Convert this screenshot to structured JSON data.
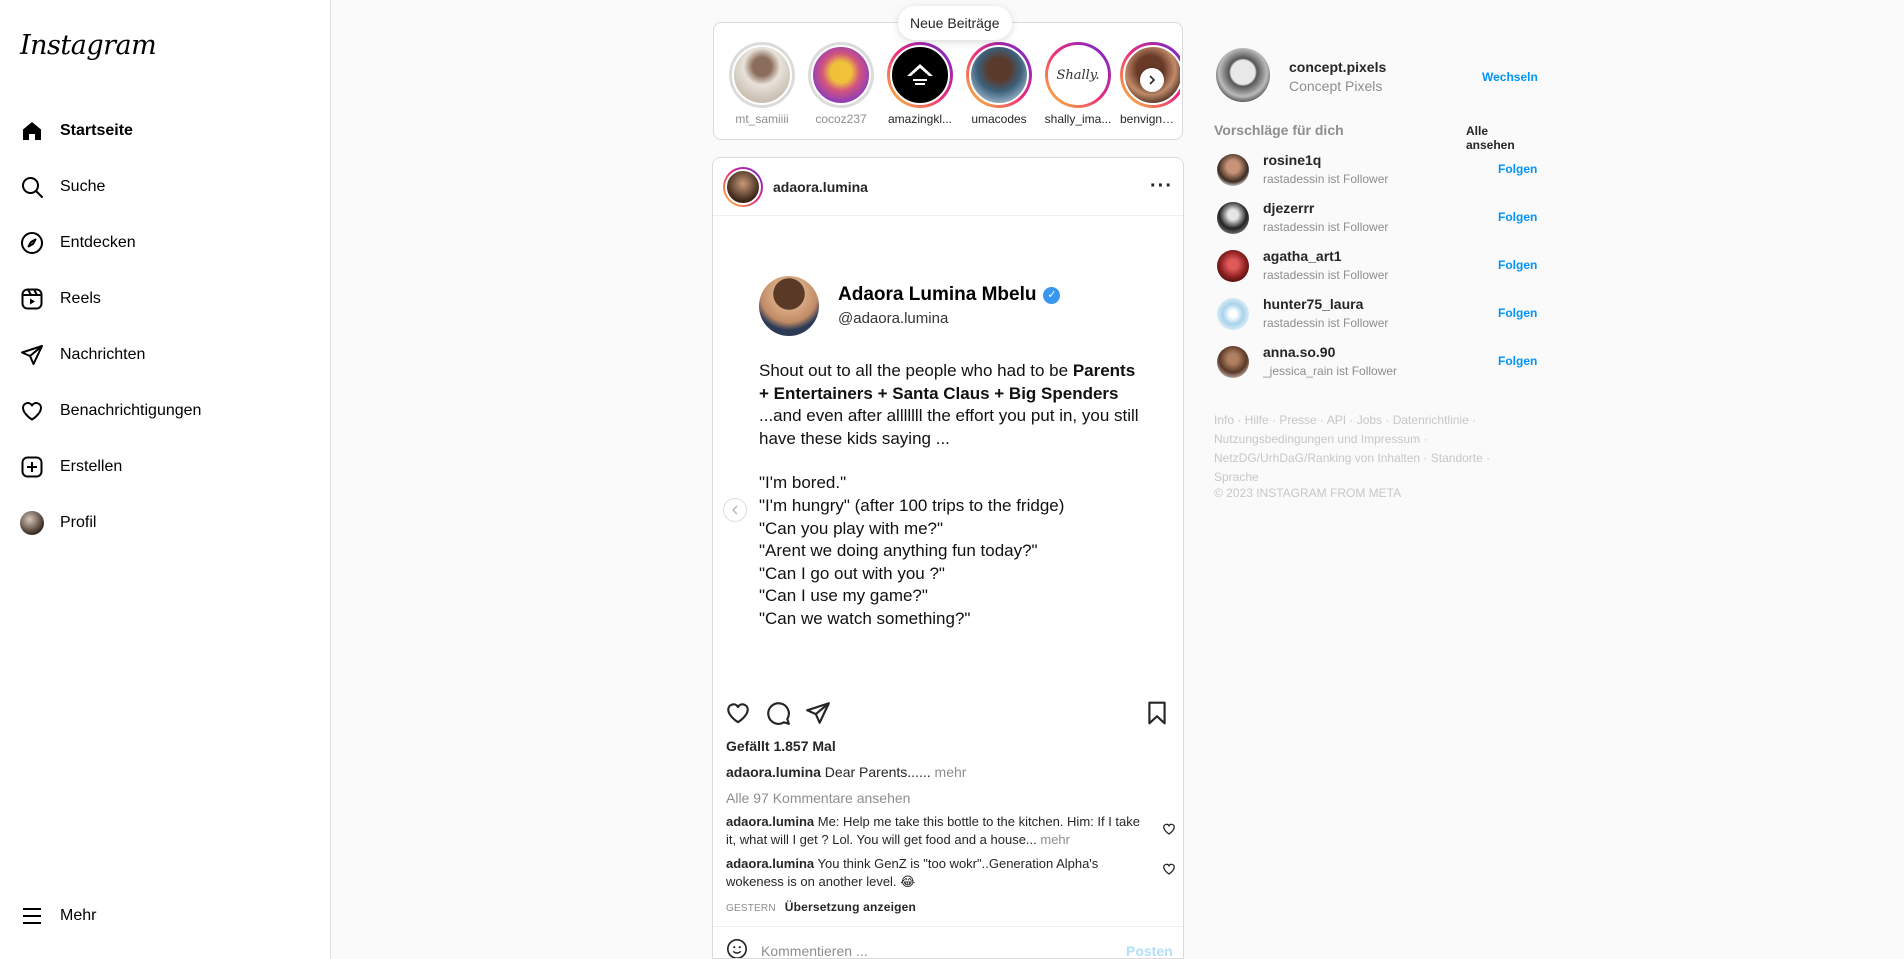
{
  "nav": {
    "logo": "Instagram",
    "items": [
      {
        "label": "Startseite",
        "icon": "home-icon"
      },
      {
        "label": "Suche",
        "icon": "search-icon"
      },
      {
        "label": "Entdecken",
        "icon": "compass-icon"
      },
      {
        "label": "Reels",
        "icon": "reels-icon"
      },
      {
        "label": "Nachrichten",
        "icon": "messages-icon"
      },
      {
        "label": "Benachrichtigungen",
        "icon": "heart-icon"
      },
      {
        "label": "Erstellen",
        "icon": "create-icon"
      },
      {
        "label": "Profil",
        "icon": "profile-avatar"
      }
    ],
    "more": "Mehr"
  },
  "stories": {
    "new_posts": "Neue Beiträge",
    "items": [
      {
        "name": "mt_samiiii",
        "seen": true
      },
      {
        "name": "cocoz237",
        "seen": true
      },
      {
        "name": "amazingkl...",
        "seen": false
      },
      {
        "name": "umacodes",
        "seen": false
      },
      {
        "name": "shally_ima...",
        "seen": false
      },
      {
        "name": "benvigna_...",
        "seen": false
      }
    ]
  },
  "post": {
    "username": "adaora.lumina",
    "image": {
      "name": "Adaora Lumina Mbelu",
      "handle": "@adaora.lumina",
      "intro": "Shout out to all the people who had to be",
      "bold": "Parents + Entertainers + Santa Claus + Big Spenders",
      "rest": " ...and even after alllllll the effort you put in, you still have these kids saying ...",
      "quotes": [
        "\"I'm bored.\"",
        "\"I'm hungry\" (after 100 trips to the fridge)",
        "\"Can you play with me?\"",
        "\"Arent we doing anything fun today?\"",
        "\"Can I go out with you ?\"",
        "\"Can I use my game?\"",
        "\"Can we watch something?\""
      ]
    },
    "likes": "Gefällt 1.857 Mal",
    "caption_user": "adaora.lumina",
    "caption_text": " Dear Parents......",
    "caption_more": " mehr",
    "all_comments": "Alle 97 Kommentare ansehen",
    "comments": [
      {
        "user": "adaora.lumina",
        "text": " Me: Help me take this bottle to the kitchen. Him: If I take it, what will I get ? Lol. You will get food and a house...",
        "more": " mehr"
      },
      {
        "user": "adaora.lumina",
        "text": " You think GenZ is \"too wokr\"..Generation Alpha's wokeness is on another level. 😂",
        "more": ""
      }
    ],
    "time": "GESTERN",
    "translate": "Übersetzung anzeigen",
    "comment_placeholder": "Kommentieren ...",
    "post_button": "Posten"
  },
  "sidebar": {
    "username": "concept.pixels",
    "fullname": "Concept Pixels",
    "switch": "Wechseln",
    "suggestions_title": "Vorschläge für dich",
    "see_all": "Alle ansehen",
    "suggestions": [
      {
        "user": "rosine1q",
        "sub": "rastadessin ist Follower",
        "action": "Folgen"
      },
      {
        "user": "djezerrr",
        "sub": "rastadessin ist Follower",
        "action": "Folgen"
      },
      {
        "user": "agatha_art1",
        "sub": "rastadessin ist Follower",
        "action": "Folgen"
      },
      {
        "user": "hunter75_laura",
        "sub": "rastadessin ist Follower",
        "action": "Folgen"
      },
      {
        "user": "anna.so.90",
        "sub": "_jessica_rain ist Follower",
        "action": "Folgen"
      }
    ],
    "footer": "Info · Hilfe · Presse · API · Jobs · Datenrichtlinie · Nutzungsbedingungen und Impressum · NetzDG/UrhDaG/Ranking von Inhalten · Standorte · Sprache",
    "copyright": "© 2023 INSTAGRAM FROM META"
  },
  "colors": {
    "accent": "#0095f6",
    "border": "#dbdbdb",
    "muted": "#8e8e8e"
  }
}
